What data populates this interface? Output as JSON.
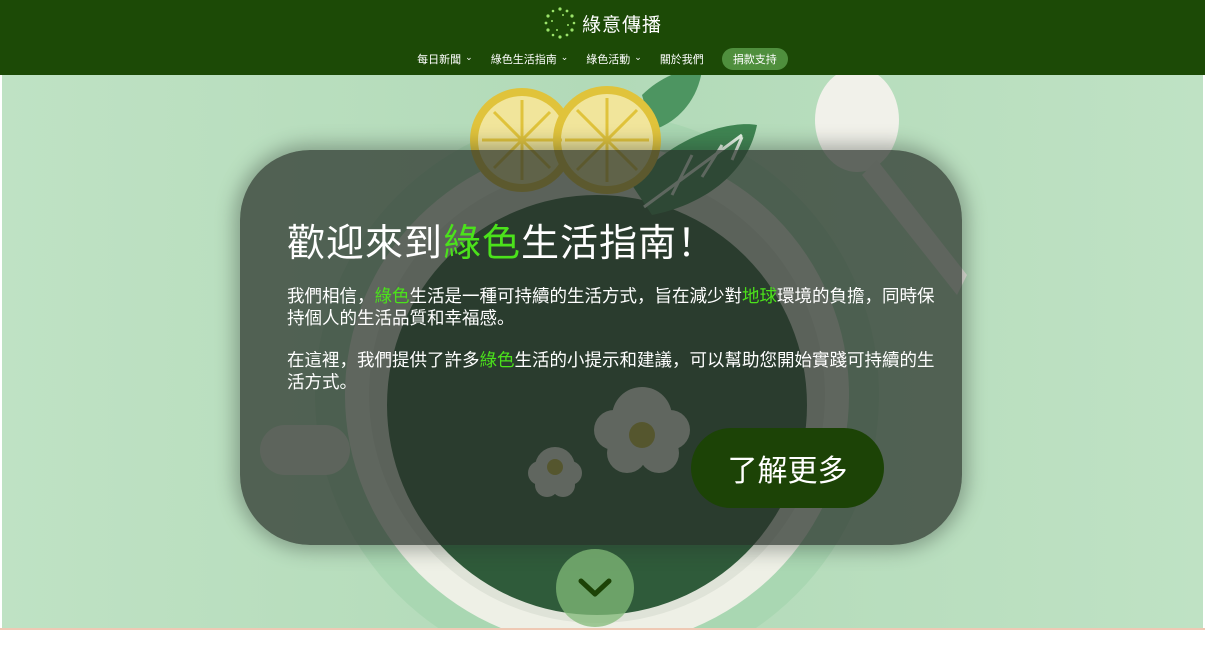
{
  "header": {
    "brand_name": "綠意傳播",
    "logo_icon": "dotted-circle-logo",
    "nav": [
      {
        "label": "每日新聞",
        "has_dropdown": true
      },
      {
        "label": "綠色生活指南",
        "has_dropdown": true
      },
      {
        "label": "綠色活動",
        "has_dropdown": true
      },
      {
        "label": "關於我們",
        "has_dropdown": false
      }
    ],
    "dropdown_chevron": "⌄",
    "donate_label": "捐款支持"
  },
  "hero": {
    "title_pre": "歡迎來到",
    "title_highlight": "綠色",
    "title_post": "生活指南！",
    "p1_a": "我們相信，",
    "p1_hl1": "綠色",
    "p1_b": "生活是一種可持續的生活方式，旨在減少對",
    "p1_hl2": "地球",
    "p1_c": "環境的負擔，同時保持個人的生活品質和幸福感。",
    "p2_a": "在這裡，我們提供了許多",
    "p2_hl": "綠色",
    "p2_b": "生活的小提示和建議，可以幫助您開始實踐可持續的生活方式。",
    "cta_label": "了解更多",
    "scroll_icon": "chevron-down-icon"
  },
  "colors": {
    "header_bg": "#1c4a06",
    "highlight": "#4be21b",
    "cta_bg": "#1c4306",
    "hero_bg": "#b6dcbc"
  }
}
